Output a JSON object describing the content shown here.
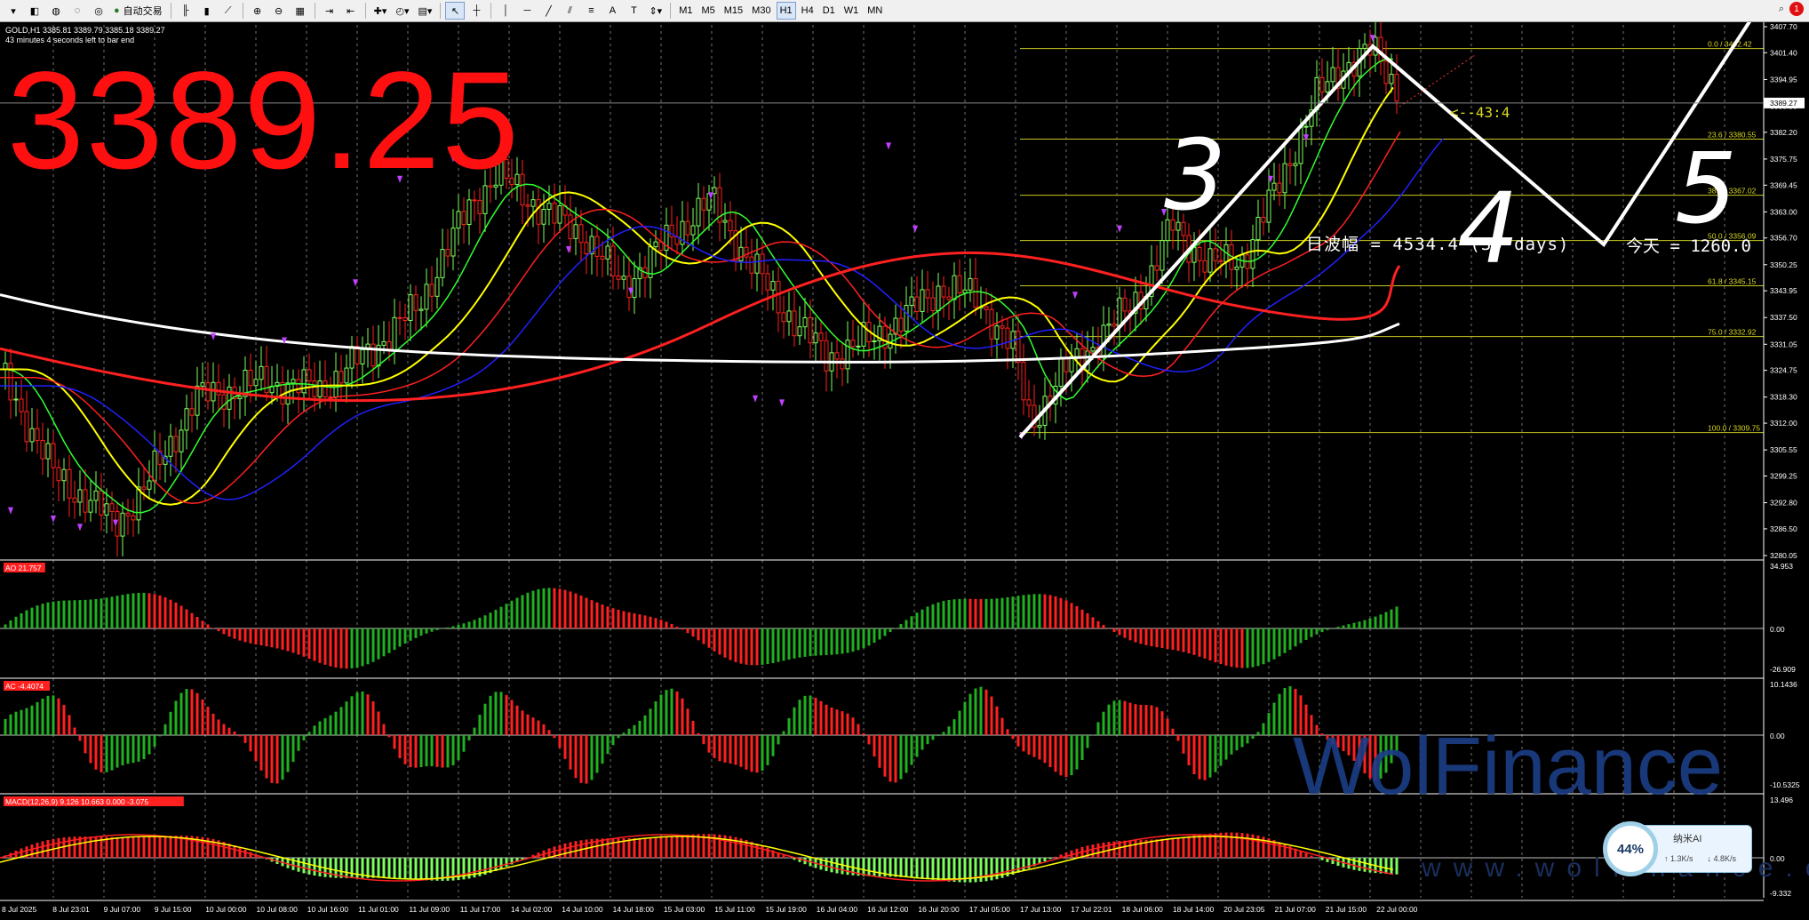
{
  "toolbar": {
    "auto_trade_label": "自动交易",
    "timeframes": [
      "M1",
      "M5",
      "M15",
      "M30",
      "H1",
      "H4",
      "D1",
      "W1",
      "MN"
    ],
    "active_timeframe": "H1",
    "notification_count": "1"
  },
  "chart": {
    "symbol_info": "GOLD,H1  3385.81 3389.79 3385.18 3389.27",
    "bar_timer": "43 minutes 4 seconds left to bar end",
    "big_price": "3389.25",
    "current_price_tag": "3389.27",
    "wave_amplitude": "日波幅 = 4534.4 (30 days)",
    "today_amplitude": "今天 = 1260.0",
    "pip_label": "<--43:4",
    "elliott_labels": [
      "3",
      "4",
      "5"
    ],
    "price_axis": [
      "3407.70",
      "3401.40",
      "3394.95",
      "3388.50",
      "3382.20",
      "3375.75",
      "3369.45",
      "3363.00",
      "3356.70",
      "3350.25",
      "3343.95",
      "3337.50",
      "3331.05",
      "3324.75",
      "3318.30",
      "3312.00",
      "3305.55",
      "3299.25",
      "3292.80",
      "3286.50",
      "3280.05"
    ],
    "fib_levels": [
      {
        "label": "0.0 / 3402.42",
        "value": 3402.42
      },
      {
        "label": "23.6 / 3380.55",
        "value": 3380.55
      },
      {
        "label": "38.2 / 3367.02",
        "value": 3367.02
      },
      {
        "label": "50.0 / 3356.09",
        "value": 3356.09
      },
      {
        "label": "61.8 / 3345.15",
        "value": 3345.15
      },
      {
        "label": "75.0 / 3332.92",
        "value": 3332.92
      },
      {
        "label": "100.0 / 3309.75",
        "value": 3309.75
      }
    ],
    "time_axis": [
      "8 Jul 2025",
      "8 Jul 23:01",
      "9 Jul 07:00",
      "9 Jul 15:00",
      "10 Jul 00:00",
      "10 Jul 08:00",
      "10 Jul 16:00",
      "11 Jul 01:00",
      "11 Jul 09:00",
      "11 Jul 17:00",
      "14 Jul 02:00",
      "14 Jul 10:00",
      "14 Jul 18:00",
      "15 Jul 03:00",
      "15 Jul 11:00",
      "15 Jul 19:00",
      "16 Jul 04:00",
      "16 Jul 12:00",
      "16 Jul 20:00",
      "17 Jul 05:00",
      "17 Jul 13:00",
      "17 Jul 22:01",
      "18 Jul 06:00",
      "18 Jul 14:00",
      "20 Jul 23:05",
      "21 Jul 07:00",
      "21 Jul 15:00",
      "22 Jul 00:00"
    ]
  },
  "indicators": {
    "ao": {
      "label": "AO 21.757",
      "top": "34.953",
      "zero": "0.00",
      "bottom": "-26.909"
    },
    "ac": {
      "label": "AC -4.4074",
      "top": "10.1436",
      "zero": "0.00",
      "bottom": "-10.5325"
    },
    "macd": {
      "label": "MACD(12,26,9) 9.126 10.663 0.000 -3.075",
      "top": "13.496",
      "zero": "0.00",
      "bottom": "-9.332"
    }
  },
  "watermark": {
    "brand": "WolFinance",
    "url": "www.wolfinance.com"
  },
  "ai_widget": {
    "gauge": "44%",
    "title": "纳米AI",
    "up_speed": "↑ 1.3K/s",
    "down_speed": "↓ 4.8K/s"
  },
  "colors": {
    "bull": "#7cff5c",
    "bear": "#ff2020",
    "ma_green": "#30ff30",
    "ma_yellow": "#ffff00",
    "ma_red": "#ff2020",
    "ma_blue": "#2020ff",
    "ma_white": "#ffffff",
    "fib": "#c8c820",
    "arrow": "#c040ff"
  }
}
